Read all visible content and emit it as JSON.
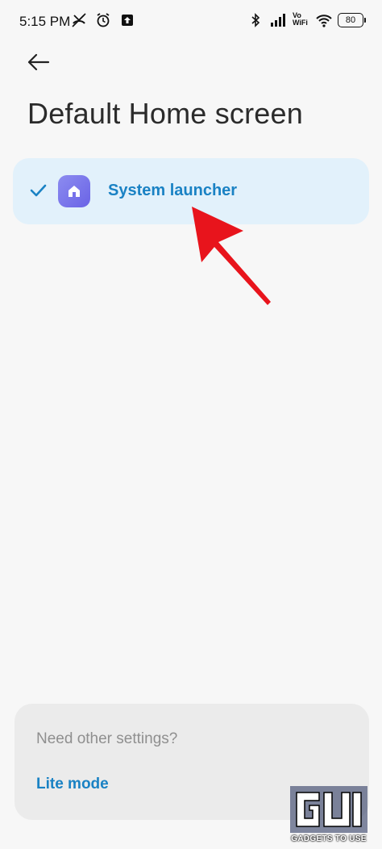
{
  "status_bar": {
    "time": "5:15 PM",
    "left_icons": [
      "missed-call-icon",
      "alarm-icon",
      "upload-icon"
    ],
    "right_icons": [
      "bluetooth-icon",
      "signal-icon",
      "volte-icon",
      "wifi-icon"
    ],
    "volte_text": "Vo\nWiFi",
    "battery": "80"
  },
  "header": {
    "back_icon": "back-arrow-icon",
    "title": "Default Home screen"
  },
  "launchers": [
    {
      "label": "System launcher",
      "selected": true,
      "icon": "home-icon"
    }
  ],
  "footer_card": {
    "prompt": "Need other settings?",
    "link_label": "Lite mode"
  },
  "watermark": {
    "caption": "GADGETS TO USE"
  },
  "colors": {
    "accent": "#1a82c4",
    "selected_row_bg": "#e2f1fb",
    "annotation_arrow": "#e8141c"
  }
}
